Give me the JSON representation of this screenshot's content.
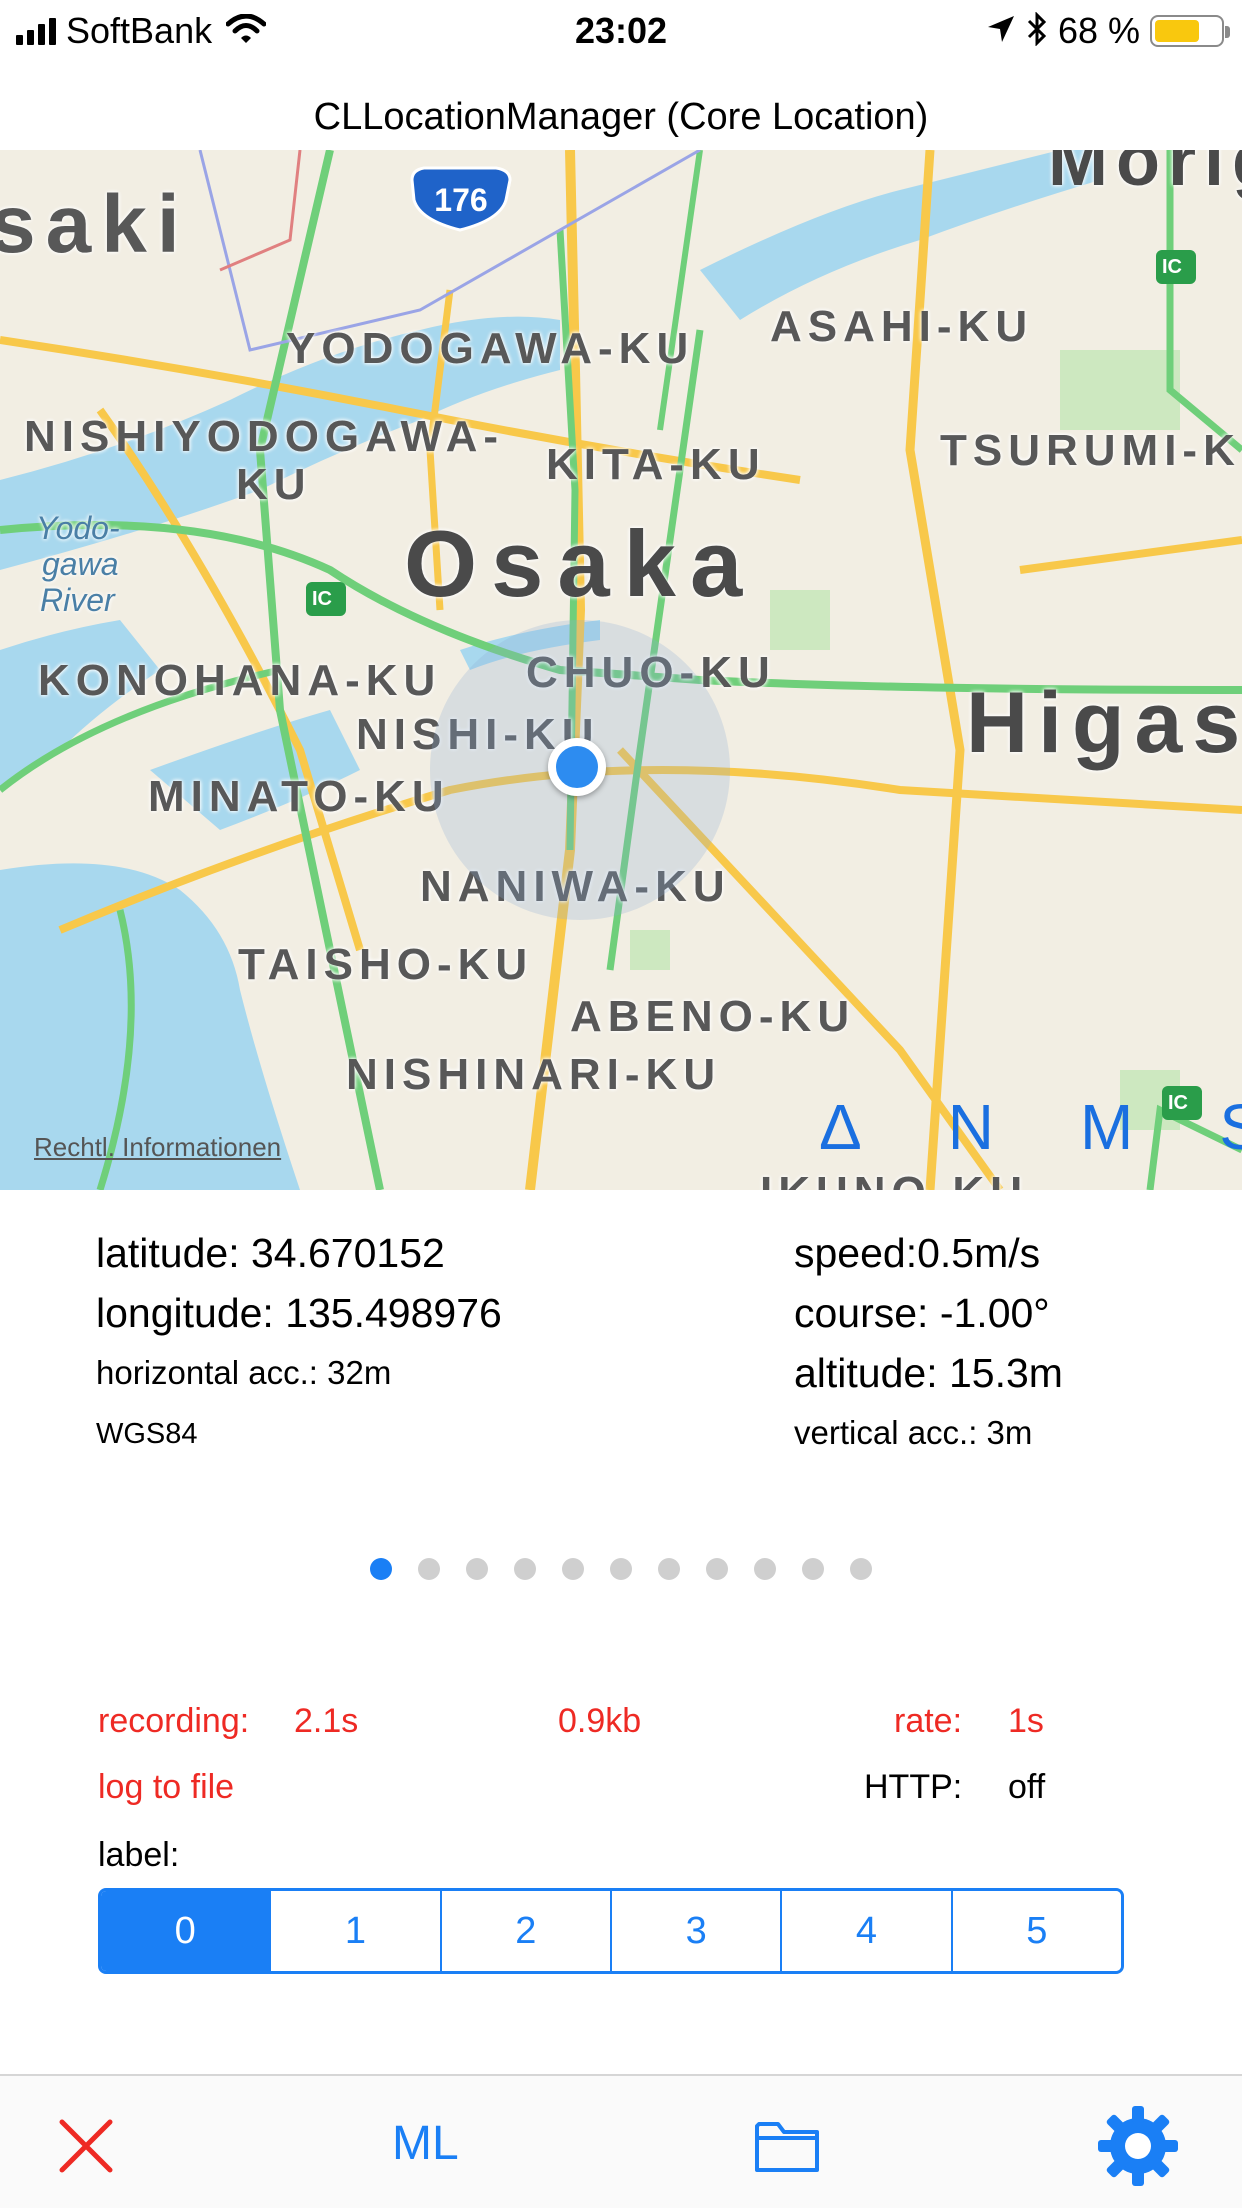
{
  "status_bar": {
    "carrier": "SoftBank",
    "time": "23:02",
    "battery_percent": "68 %",
    "battery_level": 0.68,
    "icons": [
      "signal-icon",
      "wifi-icon",
      "location-arrow-icon",
      "bluetooth-icon",
      "battery-icon"
    ]
  },
  "nav": {
    "title": "CLLocationManager (Core Location)"
  },
  "map": {
    "labels": [
      "saki",
      "YODOGAWA-KU",
      "ASAHI-KU",
      "NISHIYODOGAWA-",
      "KU",
      "KITA-KU",
      "TSURUMI-K",
      "Yodo-",
      "gawa",
      "River",
      "Osaka",
      "KONOHANA-KU",
      "CHUO-KU",
      "NISHI-KU",
      "Higas",
      "MINATO-KU",
      "NANIWA-KU",
      "TAISHO-KU",
      "ABENO-KU",
      "NISHINARI-KU",
      "Morig",
      "IKUNO-KU"
    ],
    "route_shield": "176",
    "ic_badge": "IC",
    "legal_link": "Rechtl. Informationen",
    "tools": [
      "Δ",
      "N",
      "M",
      "S"
    ]
  },
  "readouts": {
    "latitude": "latitude: 34.670152",
    "longitude": "longitude: 135.498976",
    "horizontal_acc": "horizontal acc.: 32m",
    "datum": "WGS84",
    "speed": "speed:0.5m/s",
    "course": "course: -1.00°",
    "altitude": "altitude: 15.3m",
    "vertical_acc": "vertical acc.: 3m"
  },
  "pager": {
    "count": 11,
    "current": 0
  },
  "recording": {
    "recording_label": "recording:",
    "recording_value": "2.1s",
    "size": "0.9kb",
    "rate_label": "rate:",
    "rate_value": "1s",
    "log_to_file": "log to file",
    "http_label": "HTTP:",
    "http_value": "off",
    "label_caption": "label:"
  },
  "label_segments": {
    "options": [
      "0",
      "1",
      "2",
      "3",
      "4",
      "5"
    ],
    "selected": "0"
  },
  "toolbar": {
    "close_icon": "close-icon",
    "ml_label": "ML",
    "folder_icon": "folder-icon",
    "settings_icon": "gear-icon"
  },
  "colors": {
    "accent": "#1a7ff5",
    "record_red": "#ee2a24",
    "map_land": "#f2eee3",
    "map_water": "#a8d8ee",
    "map_road_major": "#f8c84a",
    "map_road_green": "#6fcf7a"
  }
}
